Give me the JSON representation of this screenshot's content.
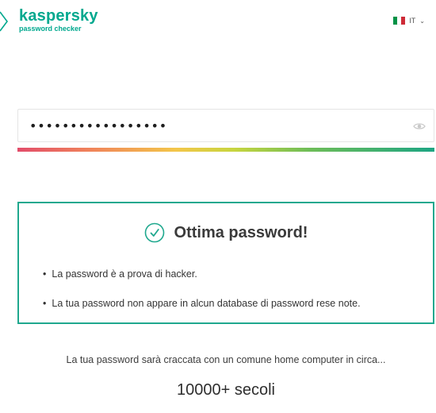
{
  "header": {
    "brand_name": "kaspersky",
    "brand_sub": "password checker",
    "brand_color": "#00a88e",
    "language": {
      "code": "IT",
      "flag_colors": [
        "#009246",
        "#ffffff",
        "#ce2b37"
      ]
    }
  },
  "password_field": {
    "value": "•••••••••••••••••",
    "toggle_icon": "eye-icon"
  },
  "strength": {
    "level": 1.0,
    "colors": [
      "#e24d6a",
      "#f3c64a",
      "#6ebd58",
      "#1da583"
    ]
  },
  "result": {
    "icon": "check-circle-icon",
    "title": "Ottima password!",
    "bullets": [
      "La password è a prova di hacker.",
      "La tua password non appare in alcun database di password rese note."
    ],
    "border_color": "#1fa88e"
  },
  "crack": {
    "intro": "La tua password sarà craccata con un comune home computer in circa...",
    "time": "10000+ secoli"
  }
}
